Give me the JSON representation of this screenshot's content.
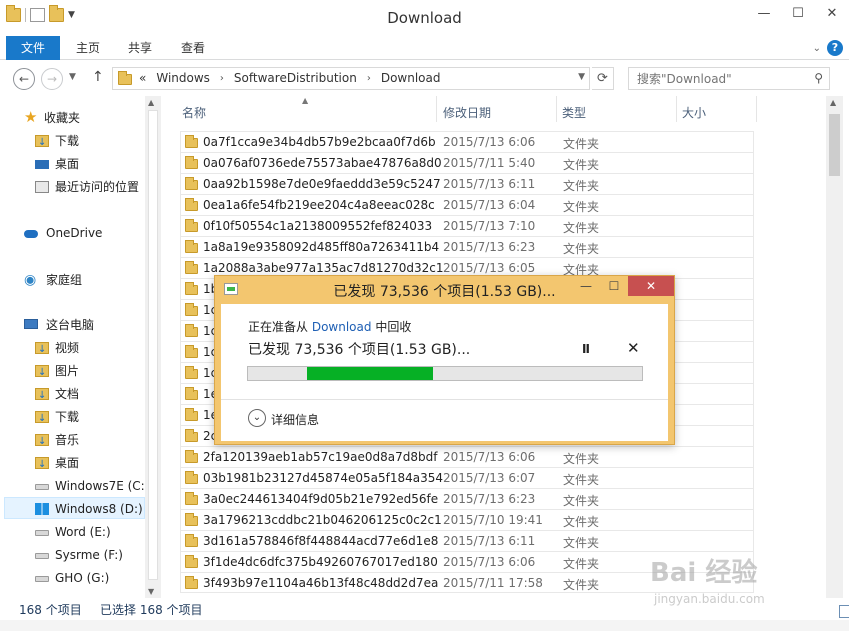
{
  "window": {
    "title": "Download",
    "minimize": "—",
    "maximize": "☐",
    "close": "✕"
  },
  "ribbon": {
    "tabs": [
      "文件",
      "主页",
      "共享",
      "查看"
    ]
  },
  "address": {
    "back": "←",
    "forward": "→",
    "up": "↑",
    "overflow": "«",
    "crumbs": [
      "Windows",
      "SoftwareDistribution",
      "Download"
    ],
    "refresh": "⟳",
    "search_placeholder": "搜索\"Download\""
  },
  "sidebar": {
    "items": [
      {
        "label": "收藏夹",
        "icon": "star-icon"
      },
      {
        "label": "下载",
        "icon": "downloads-folder-icon"
      },
      {
        "label": "桌面",
        "icon": "desktop-icon"
      },
      {
        "label": "最近访问的位置",
        "icon": "recent-places-icon"
      },
      {
        "label": "OneDrive",
        "icon": "onedrive-cloud-icon"
      },
      {
        "label": "家庭组",
        "icon": "homegroup-icon"
      },
      {
        "label": "这台电脑",
        "icon": "this-pc-icon"
      },
      {
        "label": "视频",
        "icon": "videos-folder-icon"
      },
      {
        "label": "图片",
        "icon": "pictures-folder-icon"
      },
      {
        "label": "文档",
        "icon": "documents-folder-icon"
      },
      {
        "label": "下载",
        "icon": "downloads-folder-icon"
      },
      {
        "label": "音乐",
        "icon": "music-folder-icon"
      },
      {
        "label": "桌面",
        "icon": "desktop-folder-icon"
      },
      {
        "label": "Windows7E (C:)",
        "icon": "drive-icon"
      },
      {
        "label": "Windows8 (D:)",
        "icon": "windows-drive-icon"
      },
      {
        "label": "Word (E:)",
        "icon": "drive-icon"
      },
      {
        "label": "Sysrme (F:)",
        "icon": "drive-icon"
      },
      {
        "label": "GHO (G:)",
        "icon": "drive-icon"
      }
    ]
  },
  "columns": {
    "name": "名称",
    "date": "修改日期",
    "type": "类型",
    "size": "大小"
  },
  "files": [
    {
      "name": "0a7f1cca9e34b4db57b9e2bcaa0f7d6b",
      "date": "2015/7/13 6:06",
      "type": "文件夹"
    },
    {
      "name": "0a076af0736ede75573abae47876a8d0",
      "date": "2015/7/11 5:40",
      "type": "文件夹"
    },
    {
      "name": "0aa92b1598e7de0e9faeddd3e59c5247",
      "date": "2015/7/13 6:11",
      "type": "文件夹"
    },
    {
      "name": "0ea1a6fe54fb219ee204c4a8eeac028c",
      "date": "2015/7/13 6:04",
      "type": "文件夹"
    },
    {
      "name": "0f10f50554c1a2138009552fef824033",
      "date": "2015/7/13 7:10",
      "type": "文件夹"
    },
    {
      "name": "1a8a19e9358092d485ff80a7263411b4",
      "date": "2015/7/13 6:23",
      "type": "文件夹"
    },
    {
      "name": "1a2088a3abe977a135ac7d81270d32c1",
      "date": "2015/7/13 6:05",
      "type": "文件夹"
    },
    {
      "name": "1b",
      "date": "",
      "type": ""
    },
    {
      "name": "1c",
      "date": "",
      "type": ""
    },
    {
      "name": "1c",
      "date": "",
      "type": ""
    },
    {
      "name": "1c",
      "date": "",
      "type": ""
    },
    {
      "name": "1c",
      "date": "",
      "type": ""
    },
    {
      "name": "1e",
      "date": "",
      "type": ""
    },
    {
      "name": "1e",
      "date": "",
      "type": ""
    },
    {
      "name": "2c",
      "date": "",
      "type": ""
    },
    {
      "name": "2fa120139aeb1ab57c19ae0d8a7d8bdf",
      "date": "2015/7/13 6:06",
      "type": "文件夹"
    },
    {
      "name": "03b1981b23127d45874e05a5f184a354",
      "date": "2015/7/13 6:07",
      "type": "文件夹"
    },
    {
      "name": "3a0ec244613404f9d05b21e792ed56fe",
      "date": "2015/7/13 6:23",
      "type": "文件夹"
    },
    {
      "name": "3a1796213cddbc21b046206125c0c2c1",
      "date": "2015/7/10 19:41",
      "type": "文件夹"
    },
    {
      "name": "3d161a578846f8f448844acd77e6d1e8",
      "date": "2015/7/13 6:11",
      "type": "文件夹"
    },
    {
      "name": "3f1de4dc6dfc375b49260767017ed180",
      "date": "2015/7/13 6:06",
      "type": "文件夹"
    },
    {
      "name": "3f493b97e1104a46b13f48c48dd2d7ea",
      "date": "2015/7/11 17:58",
      "type": "文件夹"
    }
  ],
  "status": {
    "count": "168 个项目",
    "selected": "已选择 168 个项目"
  },
  "dialog": {
    "title": "已发现 73,536 个项目(1.53 GB)...",
    "subtitle_prefix": "正在准备从",
    "subtitle_link": "Download",
    "subtitle_suffix": "中回收",
    "heading": "已发现 73,536 个项目(1.53 GB)...",
    "pause": "II",
    "stop": "✕",
    "details": "详细信息",
    "details_chevron": "⌄",
    "minimize": "—",
    "maximize": "☐",
    "close": "✕",
    "progress_start": 0.15,
    "progress_end": 0.47,
    "progress_color": "#06b025",
    "frame_color": "#f3c66f"
  },
  "watermark": {
    "text": "Bai 经验",
    "url": "jingyan.baidu.com"
  }
}
